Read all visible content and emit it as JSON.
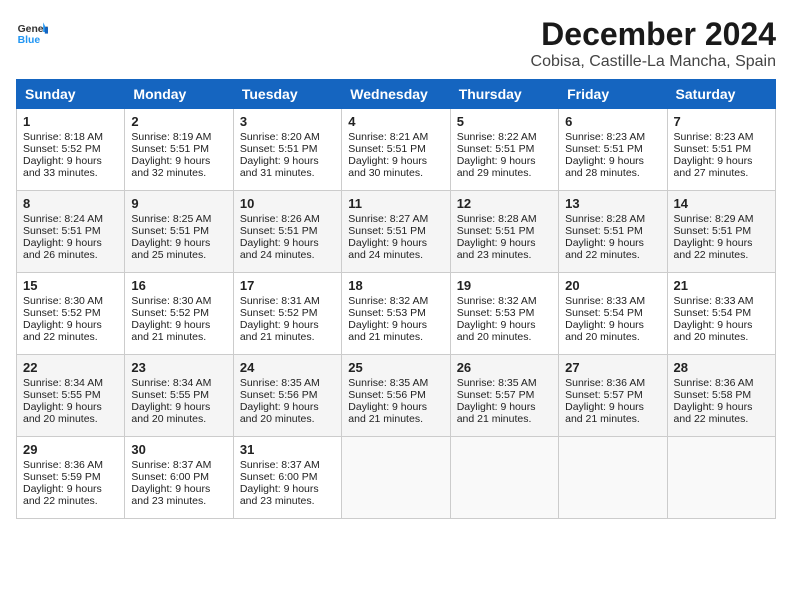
{
  "logo": {
    "line1": "General",
    "line2": "Blue"
  },
  "title": "December 2024",
  "location": "Cobisa, Castille-La Mancha, Spain",
  "days_of_week": [
    "Sunday",
    "Monday",
    "Tuesday",
    "Wednesday",
    "Thursday",
    "Friday",
    "Saturday"
  ],
  "weeks": [
    [
      {
        "day": 1,
        "sunrise": "8:18 AM",
        "sunset": "5:52 PM",
        "daylight": "9 hours and 33 minutes."
      },
      {
        "day": 2,
        "sunrise": "8:19 AM",
        "sunset": "5:51 PM",
        "daylight": "9 hours and 32 minutes."
      },
      {
        "day": 3,
        "sunrise": "8:20 AM",
        "sunset": "5:51 PM",
        "daylight": "9 hours and 31 minutes."
      },
      {
        "day": 4,
        "sunrise": "8:21 AM",
        "sunset": "5:51 PM",
        "daylight": "9 hours and 30 minutes."
      },
      {
        "day": 5,
        "sunrise": "8:22 AM",
        "sunset": "5:51 PM",
        "daylight": "9 hours and 29 minutes."
      },
      {
        "day": 6,
        "sunrise": "8:23 AM",
        "sunset": "5:51 PM",
        "daylight": "9 hours and 28 minutes."
      },
      {
        "day": 7,
        "sunrise": "8:23 AM",
        "sunset": "5:51 PM",
        "daylight": "9 hours and 27 minutes."
      }
    ],
    [
      {
        "day": 8,
        "sunrise": "8:24 AM",
        "sunset": "5:51 PM",
        "daylight": "9 hours and 26 minutes."
      },
      {
        "day": 9,
        "sunrise": "8:25 AM",
        "sunset": "5:51 PM",
        "daylight": "9 hours and 25 minutes."
      },
      {
        "day": 10,
        "sunrise": "8:26 AM",
        "sunset": "5:51 PM",
        "daylight": "9 hours and 24 minutes."
      },
      {
        "day": 11,
        "sunrise": "8:27 AM",
        "sunset": "5:51 PM",
        "daylight": "9 hours and 24 minutes."
      },
      {
        "day": 12,
        "sunrise": "8:28 AM",
        "sunset": "5:51 PM",
        "daylight": "9 hours and 23 minutes."
      },
      {
        "day": 13,
        "sunrise": "8:28 AM",
        "sunset": "5:51 PM",
        "daylight": "9 hours and 22 minutes."
      },
      {
        "day": 14,
        "sunrise": "8:29 AM",
        "sunset": "5:51 PM",
        "daylight": "9 hours and 22 minutes."
      }
    ],
    [
      {
        "day": 15,
        "sunrise": "8:30 AM",
        "sunset": "5:52 PM",
        "daylight": "9 hours and 22 minutes."
      },
      {
        "day": 16,
        "sunrise": "8:30 AM",
        "sunset": "5:52 PM",
        "daylight": "9 hours and 21 minutes."
      },
      {
        "day": 17,
        "sunrise": "8:31 AM",
        "sunset": "5:52 PM",
        "daylight": "9 hours and 21 minutes."
      },
      {
        "day": 18,
        "sunrise": "8:32 AM",
        "sunset": "5:53 PM",
        "daylight": "9 hours and 21 minutes."
      },
      {
        "day": 19,
        "sunrise": "8:32 AM",
        "sunset": "5:53 PM",
        "daylight": "9 hours and 20 minutes."
      },
      {
        "day": 20,
        "sunrise": "8:33 AM",
        "sunset": "5:54 PM",
        "daylight": "9 hours and 20 minutes."
      },
      {
        "day": 21,
        "sunrise": "8:33 AM",
        "sunset": "5:54 PM",
        "daylight": "9 hours and 20 minutes."
      }
    ],
    [
      {
        "day": 22,
        "sunrise": "8:34 AM",
        "sunset": "5:55 PM",
        "daylight": "9 hours and 20 minutes."
      },
      {
        "day": 23,
        "sunrise": "8:34 AM",
        "sunset": "5:55 PM",
        "daylight": "9 hours and 20 minutes."
      },
      {
        "day": 24,
        "sunrise": "8:35 AM",
        "sunset": "5:56 PM",
        "daylight": "9 hours and 20 minutes."
      },
      {
        "day": 25,
        "sunrise": "8:35 AM",
        "sunset": "5:56 PM",
        "daylight": "9 hours and 21 minutes."
      },
      {
        "day": 26,
        "sunrise": "8:35 AM",
        "sunset": "5:57 PM",
        "daylight": "9 hours and 21 minutes."
      },
      {
        "day": 27,
        "sunrise": "8:36 AM",
        "sunset": "5:57 PM",
        "daylight": "9 hours and 21 minutes."
      },
      {
        "day": 28,
        "sunrise": "8:36 AM",
        "sunset": "5:58 PM",
        "daylight": "9 hours and 22 minutes."
      }
    ],
    [
      {
        "day": 29,
        "sunrise": "8:36 AM",
        "sunset": "5:59 PM",
        "daylight": "9 hours and 22 minutes."
      },
      {
        "day": 30,
        "sunrise": "8:37 AM",
        "sunset": "6:00 PM",
        "daylight": "9 hours and 23 minutes."
      },
      {
        "day": 31,
        "sunrise": "8:37 AM",
        "sunset": "6:00 PM",
        "daylight": "9 hours and 23 minutes."
      },
      null,
      null,
      null,
      null
    ]
  ]
}
